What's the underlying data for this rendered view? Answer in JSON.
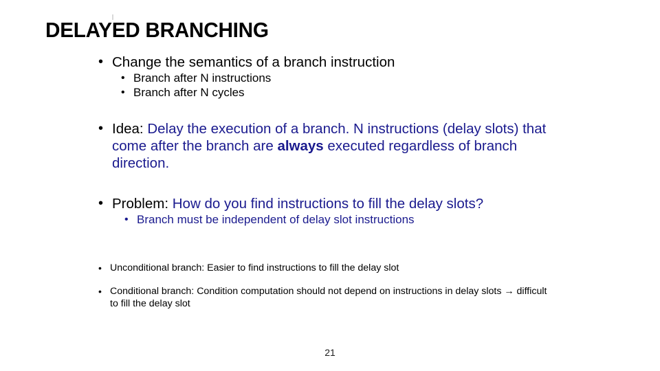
{
  "slide": {
    "title": "DELAYED BRANCHING",
    "page_number": "21",
    "bullet_marker": "•",
    "arrow_glyph": "→",
    "colors": {
      "text": "#000000",
      "accent_blue": "#1a1a8e",
      "background": "#ffffff"
    }
  },
  "content": {
    "b1": {
      "text": "Change the semantics of a branch instruction",
      "sub": [
        "Branch after N instructions",
        "Branch after N cycles"
      ]
    },
    "b2": {
      "lead": "Idea:",
      "body_a": "Delay the execution of a branch. N instructions (delay slots) that come after the branch are",
      "emphasis": "always",
      "body_b": "executed regardless of branch direction."
    },
    "b3": {
      "lead": "Problem:",
      "body": "How do you find instructions to fill the delay slots?",
      "sub": [
        "Branch must be independent of delay slot instructions"
      ]
    },
    "b4": {
      "text": "Unconditional branch: Easier to find instructions to fill the delay slot"
    },
    "b5": {
      "text_a": "Conditional branch: Condition computation should not depend on instructions in delay slots",
      "text_b": "difficult to fill the delay slot"
    }
  }
}
